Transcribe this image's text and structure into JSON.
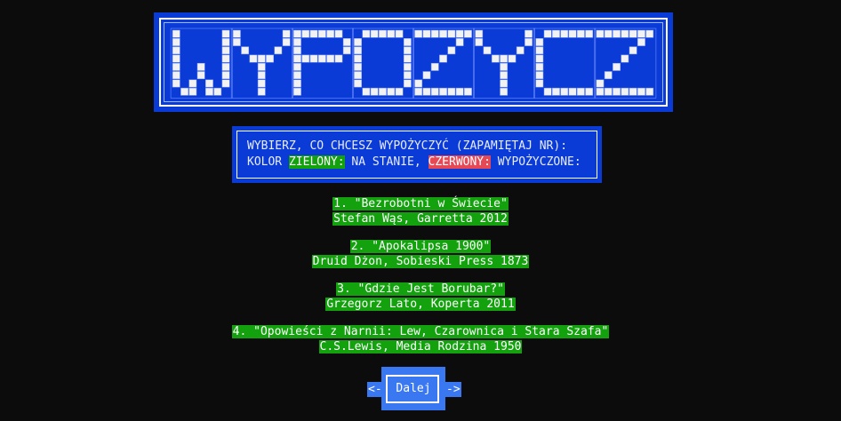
{
  "banner": {
    "title": "WYPOZYCZ"
  },
  "info": {
    "line1": "WYBIERZ, CO CHCESZ WYPOŻYCZYĆ (ZAPAMIĘTAJ NR):",
    "line2_prefix": "KOLOR ",
    "green_label": "ZIELONY:",
    "line2_middle": " NA STANIE, ",
    "red_label": "CZERWONY:",
    "line2_suffix": " WYPOŻYCZONE:"
  },
  "books": [
    {
      "title": "1. \"Bezrobotni w Świecie\"",
      "meta": "Stefan Wąs, Garretta 2012",
      "status": "available"
    },
    {
      "title": "2. \"Apokalipsa 1900\"",
      "meta": "Druid Dżon, Sobieski Press 1873",
      "status": "available"
    },
    {
      "title": "3. \"Gdzie Jest Borubar?\"",
      "meta": "Grzegorz Lato, Koperta 2011",
      "status": "available"
    },
    {
      "title": "4. \"Opowieści z Narnii: Lew, Czarownica i Stara Szafa\"",
      "meta": "C.S.Lewis, Media Rodzina 1950",
      "status": "available"
    }
  ],
  "nav": {
    "prev_arrow": "<-",
    "next_label": "Dalej",
    "next_arrow": "->"
  },
  "colors": {
    "banner_blue": "#0a3bd6",
    "available_green": "#13a10e",
    "borrowed_red": "#e74856",
    "button_blue": "#3a78f2",
    "background": "#0c0c0c"
  }
}
